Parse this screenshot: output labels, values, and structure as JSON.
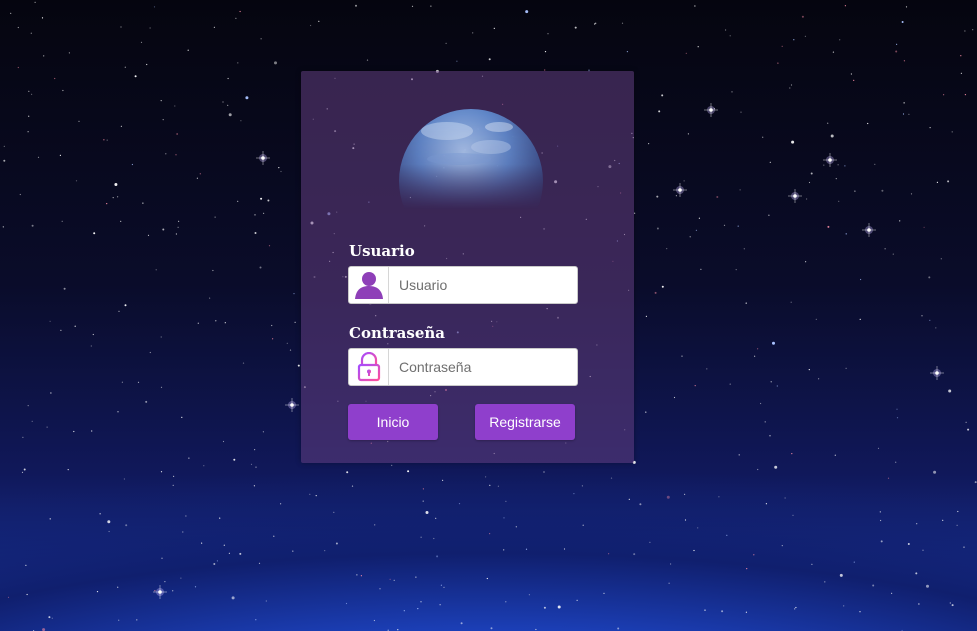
{
  "login": {
    "username_label": "Usuario",
    "username_placeholder": "Usuario",
    "username_value": "",
    "password_label": "Contraseña",
    "password_placeholder": "Contraseña",
    "password_value": "",
    "login_button": "Inicio",
    "register_button": "Registrarse"
  },
  "icons": {
    "user": "user-icon",
    "password": "lock-icon"
  },
  "colors": {
    "accent": "#8f3fcc",
    "card": "#623e80",
    "user_icon": "#8e3fb8",
    "lock_icon_start": "#a44cff",
    "lock_icon_end": "#ff4f9a"
  }
}
